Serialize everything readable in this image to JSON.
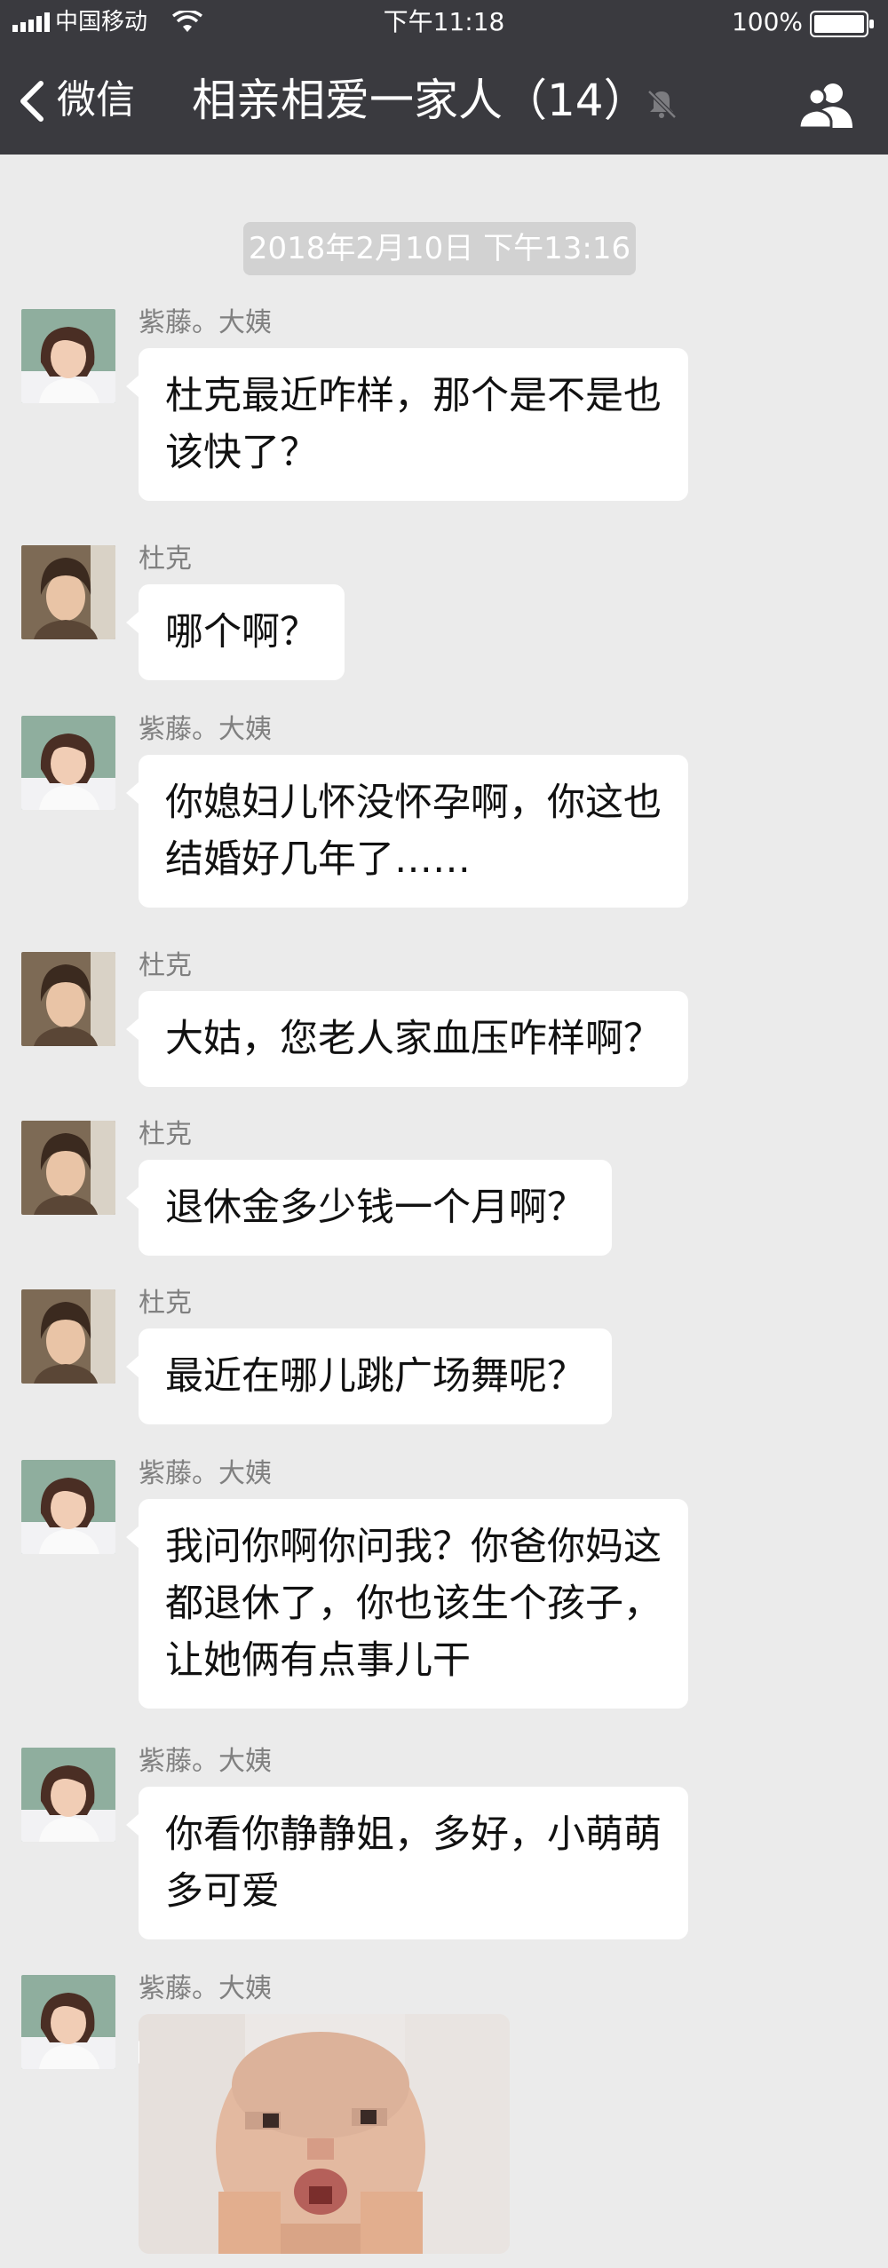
{
  "status_bar": {
    "carrier": "中国移动",
    "time": "下午11:18",
    "battery": "100%"
  },
  "nav": {
    "back_label": "微信",
    "title": "相亲相爱一家人（14）"
  },
  "timestamp": "2018年2月10日 下午13:16",
  "messages": [
    {
      "sender": "紫藤。大姨",
      "lines": [
        "杜克最近咋样，那个是不是也",
        "该快了？"
      ]
    },
    {
      "sender": "杜克",
      "lines": [
        "哪个啊？"
      ]
    },
    {
      "sender": "紫藤。大姨",
      "lines": [
        "你媳妇儿怀没怀孕啊，你这也",
        "结婚好几年了……"
      ]
    },
    {
      "sender": "杜克",
      "lines": [
        "大姑，您老人家血压咋样啊？"
      ]
    },
    {
      "sender": "杜克",
      "lines": [
        "退休金多少钱一个月啊？"
      ]
    },
    {
      "sender": "杜克",
      "lines": [
        "最近在哪儿跳广场舞呢？"
      ]
    },
    {
      "sender": "紫藤。大姨",
      "lines": [
        "我问你啊你问我？你爸你妈这",
        "都退休了，你也该生个孩子，",
        "让她俩有点事儿干"
      ]
    },
    {
      "sender": "紫藤。大姨",
      "lines": [
        "你看你静静姐，多好，小萌萌",
        "多可爱"
      ]
    },
    {
      "sender": "紫藤。大姨",
      "image": "pixelated-baby-photo"
    }
  ],
  "colors": {
    "bar": "#3a3a3f",
    "background": "#ebebeb",
    "bubble": "#ffffff",
    "timestamp_pill": "#d2d2d2",
    "sender_text": "#808080"
  }
}
